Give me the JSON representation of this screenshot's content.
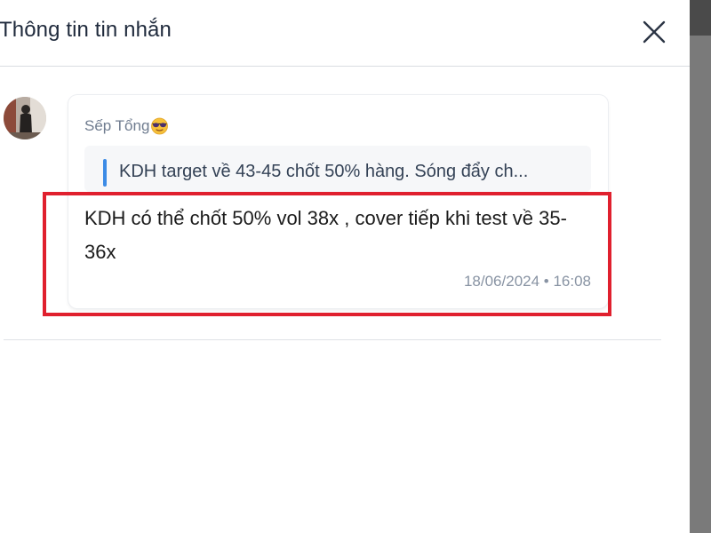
{
  "header": {
    "title": "Thông tin tin nhắn",
    "close_icon": "close-icon"
  },
  "message": {
    "sender": "Sếp Tổng",
    "sender_emoji": "sunglasses-emoji-icon",
    "quote_text": "KDH target về 43-45 chốt 50% hàng. Sóng đẩy ch...",
    "text": "KDH có thể chốt 50% vol 38x , cover tiếp khi test về 35-36x",
    "timestamp": "18/06/2024 • 16:08"
  },
  "colors": {
    "highlight": "#e0202e",
    "quote_bar": "#3c8be6",
    "title": "#1f2a3c"
  }
}
